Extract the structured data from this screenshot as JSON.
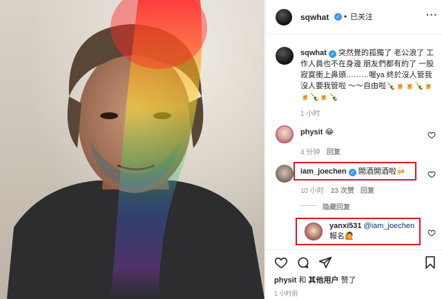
{
  "post": {
    "author": "sqwhat",
    "follow_status": "已关注",
    "dot": "•",
    "caption": "突然覺的孤獨了 老公浪了 工作人員也不在身邊 朋友們都有約了 一股寂寞衝上鼻頭………喔ya 終於沒人管我 沒人要我管啦 ～～自由啦🍾🍺🍺🍾🍺🍺🍾🍺🍾",
    "caption_time": "1 小时"
  },
  "comments": [
    {
      "user": "physit",
      "text": "😂",
      "time": "4 分钟",
      "reply": "回复"
    },
    {
      "user": "iam_joechen",
      "text": "開酒開酒啦🍻",
      "time": "10 小时",
      "likes": "23 次赞",
      "reply": "回复",
      "view_replies": "隐藏回复"
    },
    {
      "user": "yanxi531",
      "mention": "@iam_joechen",
      "text": "報名🙋",
      "time": ""
    }
  ],
  "footer": {
    "liker": "physit",
    "and": "和",
    "others": "其他用户",
    "liked": "赞了",
    "time": "1 小时前"
  },
  "colors": {
    "verified": "#3897f0",
    "highlight": "#e0141e",
    "mention": "#00376b"
  }
}
